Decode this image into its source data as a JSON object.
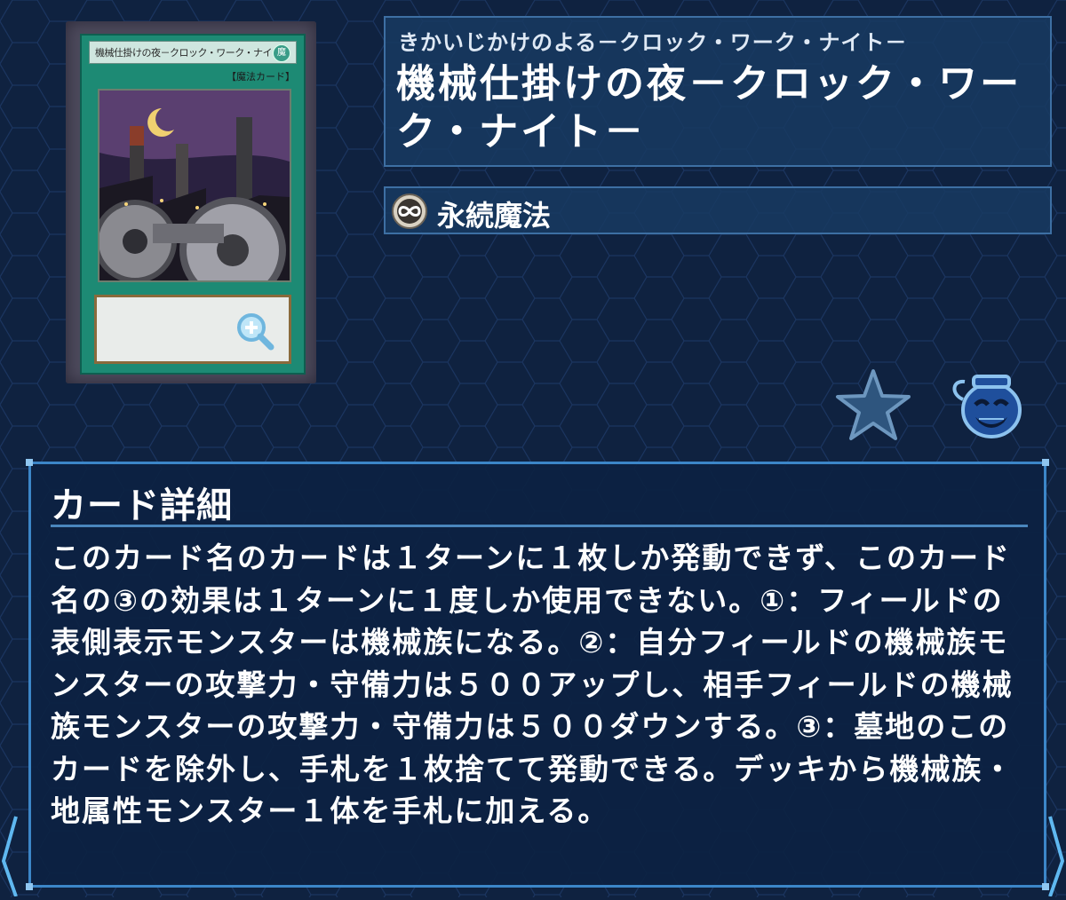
{
  "card": {
    "image_name_text": "機械仕掛けの夜－クロック・ワーク・ナイト－",
    "image_type_text": "【魔法カード】",
    "image_attr_text": "魔"
  },
  "header": {
    "ruby": "きかいじかけのよる－クロック・ワーク・ナイト－",
    "title": "機械仕掛けの夜－クロック・ワーク・ナイト－"
  },
  "type": {
    "icon": "continuous-spell-icon",
    "label": "永続魔法"
  },
  "actions": {
    "favorite_icon": "star-icon",
    "pot_icon": "pot-of-greed-icon"
  },
  "detail": {
    "heading": "カード詳細",
    "text": "このカード名のカードは１ターンに１枚しか発動できず、このカード名の③の効果は１ターンに１度しか使用できない。①：フィールドの表側表示モンスターは機械族になる。②：自分フィールドの機械族モンスターの攻撃力・守備力は５００アップし、相手フィールドの機械族モンスターの攻撃力・守備力は５００ダウンする。③：墓地のこのカードを除外し、手札を１枚捨てて発動できる。デッキから機械族・地属性モンスター１体を手札に加える。"
  },
  "colors": {
    "background": "#0f2240",
    "panel_border": "#3c86c8",
    "card_frame": "#1d8a74"
  }
}
